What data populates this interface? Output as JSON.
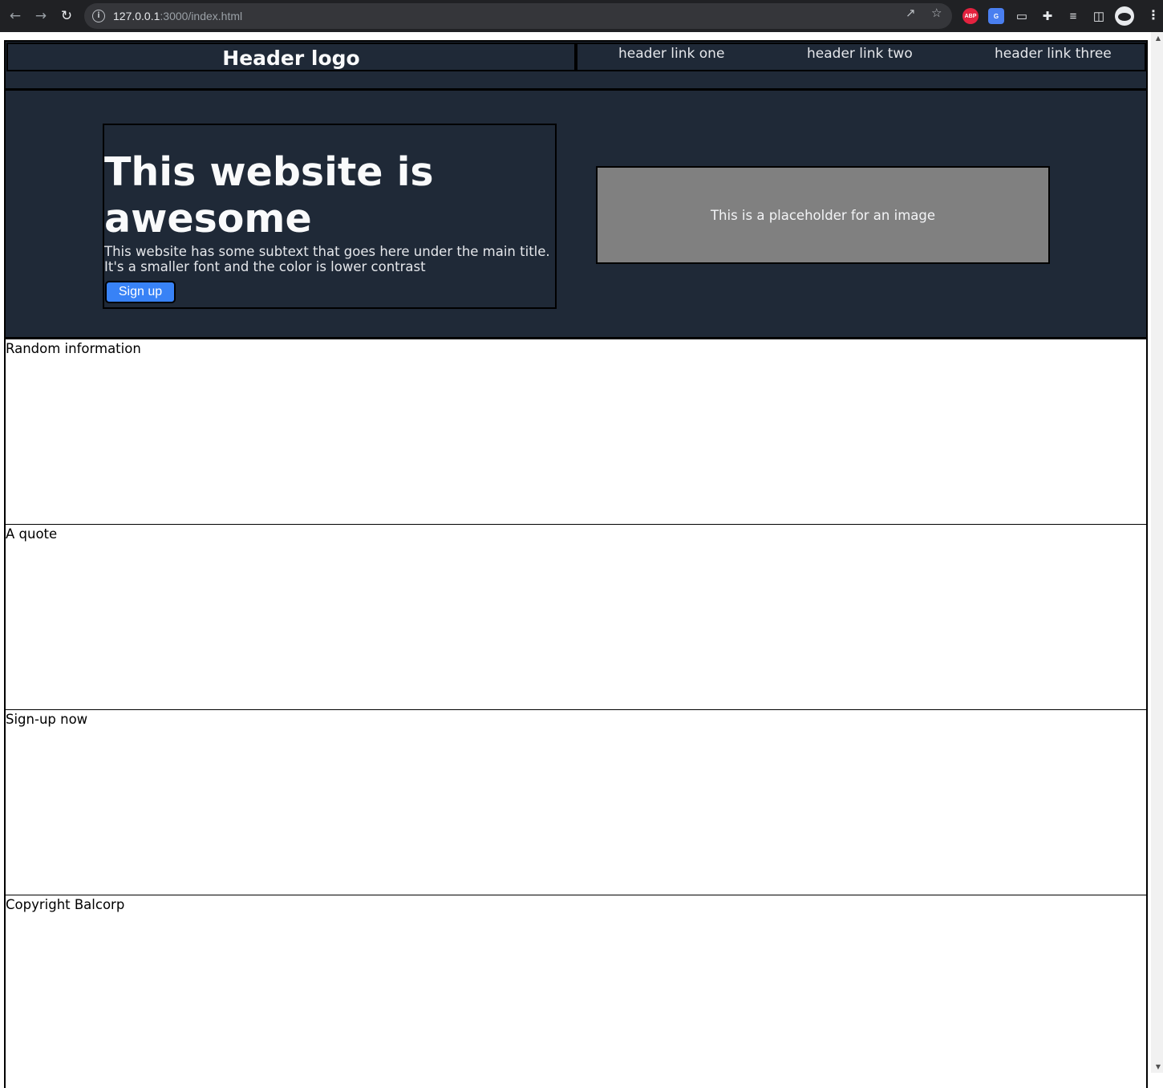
{
  "browser": {
    "url_host": "127.0.0.1",
    "url_rest": ":3000/index.html",
    "icons": {
      "back": "arrow-left-icon",
      "forward": "arrow-right-icon",
      "reload": "reload-icon",
      "site_info": "info-icon",
      "share": "share-icon",
      "bookmark": "star-icon",
      "adblock": "abp-extension-icon",
      "translate": "google-translate-icon",
      "cast": "cast-icon",
      "extensions": "puzzle-icon",
      "reading_list": "reading-list-icon",
      "side_panel": "side-panel-icon",
      "profile": "profile-avatar",
      "menu": "kebab-menu-icon"
    },
    "adblock_label": "ABP"
  },
  "header": {
    "logo": "Header logo",
    "links": [
      "header link one",
      "header link two",
      "header link three"
    ]
  },
  "hero": {
    "title": "This website is awesome",
    "subtext": "This website has some subtext that goes here under the main title. It's a smaller font and the color is lower contrast",
    "button": "Sign up",
    "image_placeholder": "This is a placeholder for an image",
    "colors": {
      "background": "#1f2937",
      "button": "#3882f6",
      "placeholder": "#808080"
    }
  },
  "sections": [
    {
      "label": "Random information"
    },
    {
      "label": "A quote"
    },
    {
      "label": "Sign-up now"
    },
    {
      "label": "Copyright Balcorp"
    }
  ]
}
